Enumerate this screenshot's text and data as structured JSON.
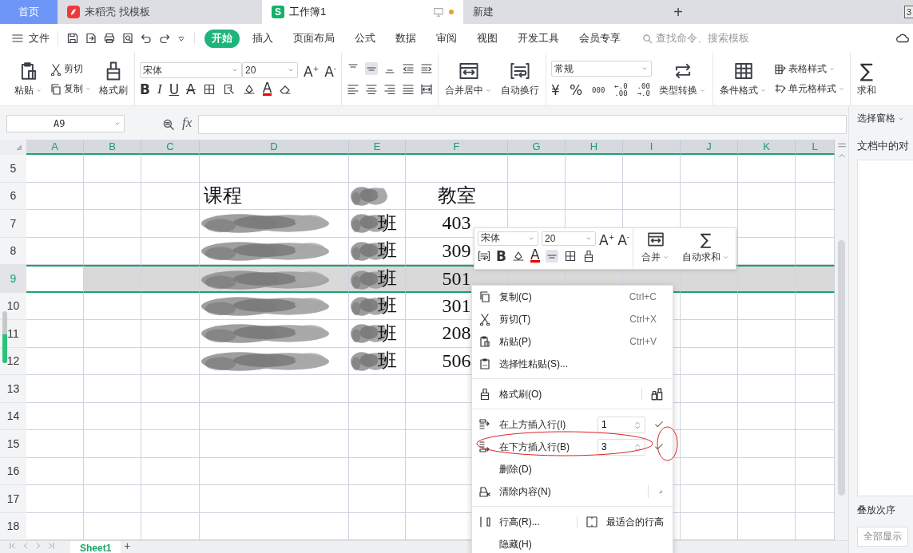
{
  "title_tabs": [
    {
      "label": "首页",
      "kind": "home",
      "selected": false
    },
    {
      "label": "来稻壳 找模板",
      "kind": "docer",
      "selected": false
    },
    {
      "label": "工作簿1",
      "kind": "sheet",
      "logo": "S",
      "selected": true
    },
    {
      "label": "新建",
      "kind": "plain",
      "selected": false
    }
  ],
  "new_tab": "+",
  "window_count": "3",
  "menu_bar": {
    "file": "文件",
    "tabs": [
      {
        "label": "开始",
        "selected": true
      },
      {
        "label": "插入",
        "selected": false
      },
      {
        "label": "页面布局",
        "selected": false
      },
      {
        "label": "公式",
        "selected": false
      },
      {
        "label": "数据",
        "selected": false
      },
      {
        "label": "审阅",
        "selected": false
      },
      {
        "label": "视图",
        "selected": false
      },
      {
        "label": "开发工具",
        "selected": false
      },
      {
        "label": "会员专享",
        "selected": false
      }
    ],
    "search_placeholder": "查找命令、搜索模板"
  },
  "ribbon": {
    "paste": "粘贴",
    "cut": "剪切",
    "copy": "复制",
    "format_painter": "格式刷",
    "font": "宋体",
    "font_size": "20",
    "grow": "A$^{+}$",
    "shrink": "A$^{-}$",
    "bold": "B",
    "italic": "I",
    "underline": "U",
    "strike": "A",
    "font_color": "A",
    "merge": "合并居中",
    "wrap": "自动换行",
    "number_format": "常规",
    "currency": "¥",
    "percent": "%",
    "thousands": "000",
    "decimal_increase": [
      "←.0",
      ".00"
    ],
    "decimal_decrease": [
      ".00",
      "→.0"
    ],
    "convert": "类型转换",
    "conditional": "条件格式",
    "table_style": "表格样式",
    "cell_style": "单元格样式",
    "sum_symbol": "∑",
    "sum": "求和"
  },
  "formula_bar": {
    "cell": "A9",
    "fx": "fx"
  },
  "sheet": {
    "columns": [
      {
        "label": "A"
      },
      {
        "label": "B"
      },
      {
        "label": "C"
      },
      {
        "label": "D"
      },
      {
        "label": "E"
      },
      {
        "label": "F"
      },
      {
        "label": "G"
      },
      {
        "label": "H"
      },
      {
        "label": "I"
      },
      {
        "label": "J"
      },
      {
        "label": "K"
      },
      {
        "label": "L"
      }
    ],
    "rows": [
      {
        "label": "5",
        "selected": false
      },
      {
        "label": "6",
        "selected": false,
        "course": {
          "text": "课程"
        },
        "class": {
          "smudge": true
        },
        "room": {
          "text": "教室"
        }
      },
      {
        "label": "7",
        "selected": false,
        "course": {
          "smudge": true
        },
        "class": {
          "text": "班",
          "smudge": true
        },
        "room": {
          "text": "403"
        }
      },
      {
        "label": "8",
        "selected": false,
        "course": {
          "smudge": true
        },
        "class": {
          "text": "班",
          "smudge": true
        },
        "room": {
          "text": "309"
        }
      },
      {
        "label": "9",
        "selected": true,
        "course": {
          "smudge": true
        },
        "class": {
          "text": "班",
          "smudge": true
        },
        "room": {
          "text": "501"
        }
      },
      {
        "label": "10",
        "selected": false,
        "course": {
          "smudge": true
        },
        "class": {
          "text": "班",
          "smudge": true
        },
        "room": {
          "text": "301"
        }
      },
      {
        "label": "11",
        "selected": false,
        "course": {
          "smudge": true
        },
        "class": {
          "text": "班",
          "smudge": true
        },
        "room": {
          "text": "208"
        }
      },
      {
        "label": "12",
        "selected": false,
        "course": {
          "smudge": true
        },
        "class": {
          "text": "班",
          "smudge": true
        },
        "room": {
          "text": "506"
        }
      },
      {
        "label": "13",
        "selected": false
      },
      {
        "label": "14",
        "selected": false
      },
      {
        "label": "15",
        "selected": false
      },
      {
        "label": "16",
        "selected": false
      },
      {
        "label": "17",
        "selected": false
      },
      {
        "label": "18",
        "selected": false
      }
    ],
    "sheet_tabs": [
      {
        "label": "Sheet1",
        "selected": true
      }
    ],
    "add_sheet": "+"
  },
  "side_pane": {
    "title": "选择窗格",
    "heading": "文档中的对",
    "order": "叠放次序",
    "show_all": "全部显示"
  },
  "mini_toolbar": {
    "font": "宋体",
    "size": "20",
    "grow": "A$^{+}$",
    "shrink": "A$^{-}$",
    "bold": "B",
    "font_color": "A",
    "merge": "合并",
    "sum_symbol": "∑",
    "autosum": "自动求和"
  },
  "context_menu": {
    "items": [
      {
        "kind": "command",
        "label": "复制(C)",
        "shortcut": "Ctrl+C",
        "submenu": false
      },
      {
        "kind": "command",
        "label": "剪切(T)",
        "shortcut": "Ctrl+X",
        "submenu": false
      },
      {
        "kind": "command",
        "label": "粘贴(P)",
        "shortcut": "Ctrl+V",
        "submenu": false
      },
      {
        "kind": "command",
        "label": "选择性粘贴(S)...",
        "submenu": false
      },
      {
        "kind": "separator"
      },
      {
        "kind": "tool",
        "label": "格式刷(O)"
      },
      {
        "kind": "separator"
      },
      {
        "kind": "stepper",
        "label": "在上方插入行(I)",
        "value": "1"
      },
      {
        "kind": "stepper",
        "label": "在下方插入行(B)",
        "value": "3"
      },
      {
        "kind": "command",
        "label": "删除(D)",
        "submenu": false
      },
      {
        "kind": "command",
        "label": "清除内容(N)",
        "submenu": true
      },
      {
        "kind": "separator"
      },
      {
        "kind": "split",
        "label": "行高(R)...",
        "second_label": "最适合的行高"
      },
      {
        "kind": "command",
        "label": "隐藏(H)",
        "submenu": false
      }
    ]
  }
}
